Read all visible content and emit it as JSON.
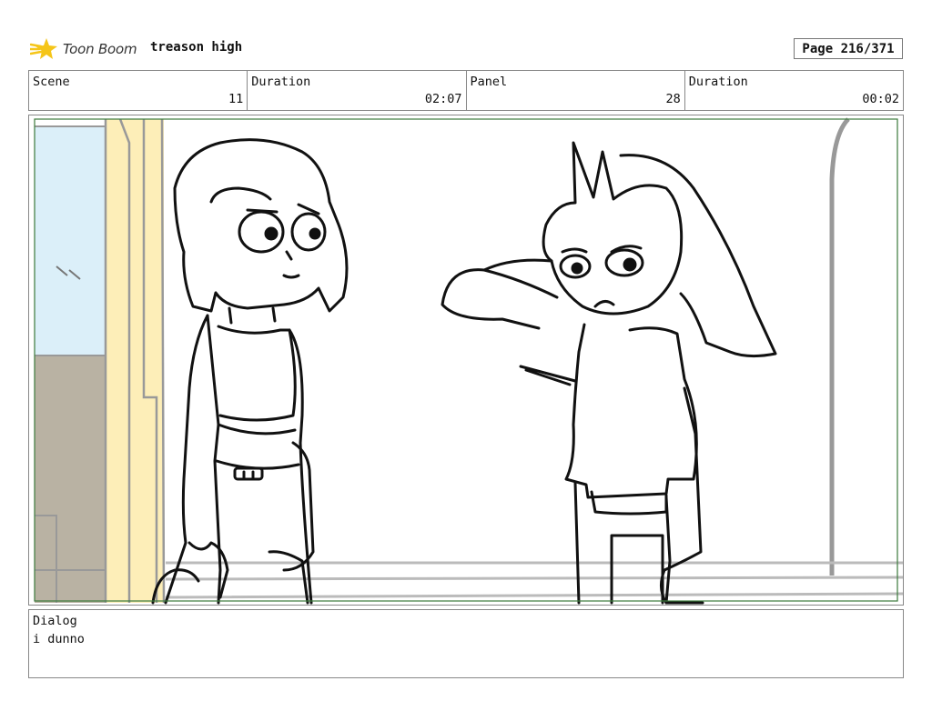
{
  "header": {
    "logo_text": "Toon Boom",
    "project_title": "treason high",
    "page_counter": "Page 216/371"
  },
  "info": {
    "scene_label": "Scene",
    "scene_value": "11",
    "scene_duration_label": "Duration",
    "scene_duration_value": "02:07",
    "panel_label": "Panel",
    "panel_value": "28",
    "panel_duration_label": "Duration",
    "panel_duration_value": "00:02"
  },
  "dialog": {
    "label": "Dialog",
    "text": "i dunno"
  },
  "colors": {
    "logo_accent": "#f5c518",
    "window_blue": "#dbeff9",
    "door_yellow": "#fdeeb8",
    "wall_taupe": "#b9b2a3",
    "safe_area_green": "#3b7a3b"
  }
}
